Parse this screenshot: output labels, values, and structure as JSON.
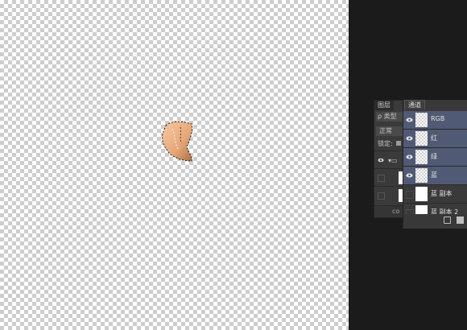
{
  "layers_panel": {
    "tab_label": "图层",
    "search_label": "ρ 类型",
    "blend_mode": "正常",
    "lock_label": "锁定:",
    "link_icon": "co"
  },
  "channels_panel": {
    "tab_label": "通道",
    "channels": [
      {
        "name": "RGB",
        "visible": true,
        "selected": true
      },
      {
        "name": "红",
        "visible": true,
        "selected": true
      },
      {
        "name": "绿",
        "visible": true,
        "selected": true
      },
      {
        "name": "蓝",
        "visible": true,
        "selected": true
      },
      {
        "name": "蓝 副本",
        "visible": false,
        "selected": false
      },
      {
        "name": "蓝 副本 2",
        "visible": false,
        "selected": false
      }
    ]
  },
  "colors": {
    "selected_row": "#515a74",
    "panel_bg": "#393939",
    "workspace_bg": "#1b1b1b"
  }
}
